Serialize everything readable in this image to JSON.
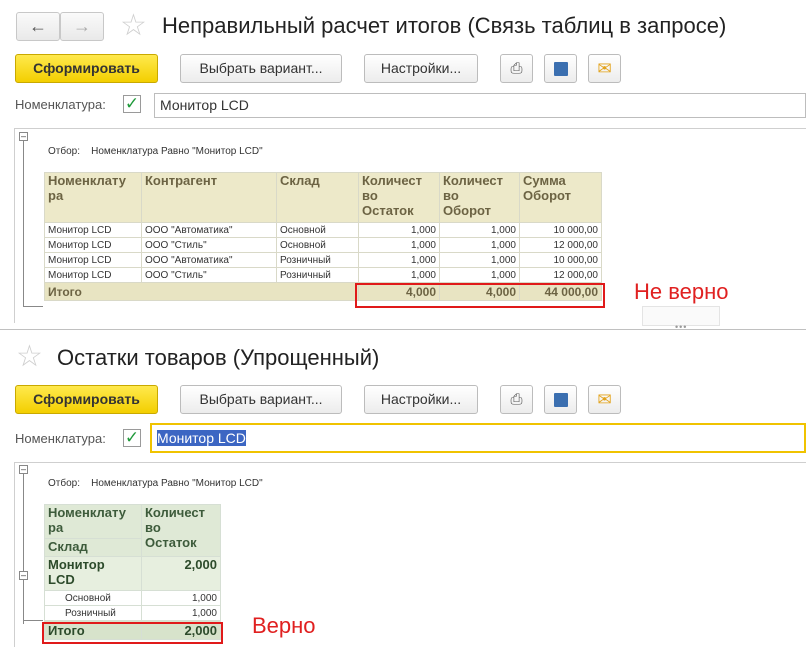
{
  "window1": {
    "title": "Неправильный расчет итогов (Связь таблиц в запросе)",
    "toolbar": {
      "generate": "Сформировать",
      "choose_variant": "Выбрать вариант...",
      "settings": "Настройки..."
    },
    "filter_label": "Номенклатура:",
    "filter_value": "Монитор LCD",
    "report": {
      "filter_text": "Отбор:",
      "filter_condition": "Номенклатура Равно \"Монитор LCD\"",
      "headers": [
        "Номенклату\nра",
        "Контрагент",
        "Склад",
        "Количест\nво\nОстаток",
        "Количест\nво\nОборот",
        "Сумма\nОборот"
      ],
      "rows": [
        [
          "Монитор LCD",
          "ООО \"Автоматика\"",
          "Основной",
          "1,000",
          "1,000",
          "10 000,00"
        ],
        [
          "Монитор LCD",
          "ООО \"Стиль\"",
          "Основной",
          "1,000",
          "1,000",
          "12 000,00"
        ],
        [
          "Монитор LCD",
          "ООО \"Автоматика\"",
          "Розничный",
          "1,000",
          "1,000",
          "10 000,00"
        ],
        [
          "Монитор LCD",
          "ООО \"Стиль\"",
          "Розничный",
          "1,000",
          "1,000",
          "12 000,00"
        ]
      ],
      "total_label": "Итого",
      "totals": [
        "4,000",
        "4,000",
        "44 000,00"
      ]
    },
    "annotation": "Не верно"
  },
  "window2": {
    "title": "Остатки товаров (Упрощенный)",
    "toolbar": {
      "generate": "Сформировать",
      "choose_variant": "Выбрать вариант...",
      "settings": "Настройки..."
    },
    "filter_label": "Номенклатура:",
    "filter_value": "Монитор LCD",
    "report": {
      "filter_text": "Отбор:",
      "filter_condition": "Номенклатура Равно \"Монитор LCD\"",
      "header_col1_a": "Номенклату\nра",
      "header_col1_b": "Склад",
      "header_col2": "Количест\nво\nОстаток",
      "group_name": "Монитор\nLCD",
      "group_value": "2,000",
      "rows": [
        [
          "Основной",
          "1,000"
        ],
        [
          "Розничный",
          "1,000"
        ]
      ],
      "total_label": "Итого",
      "total_value": "2,000"
    },
    "annotation": "Верно"
  }
}
